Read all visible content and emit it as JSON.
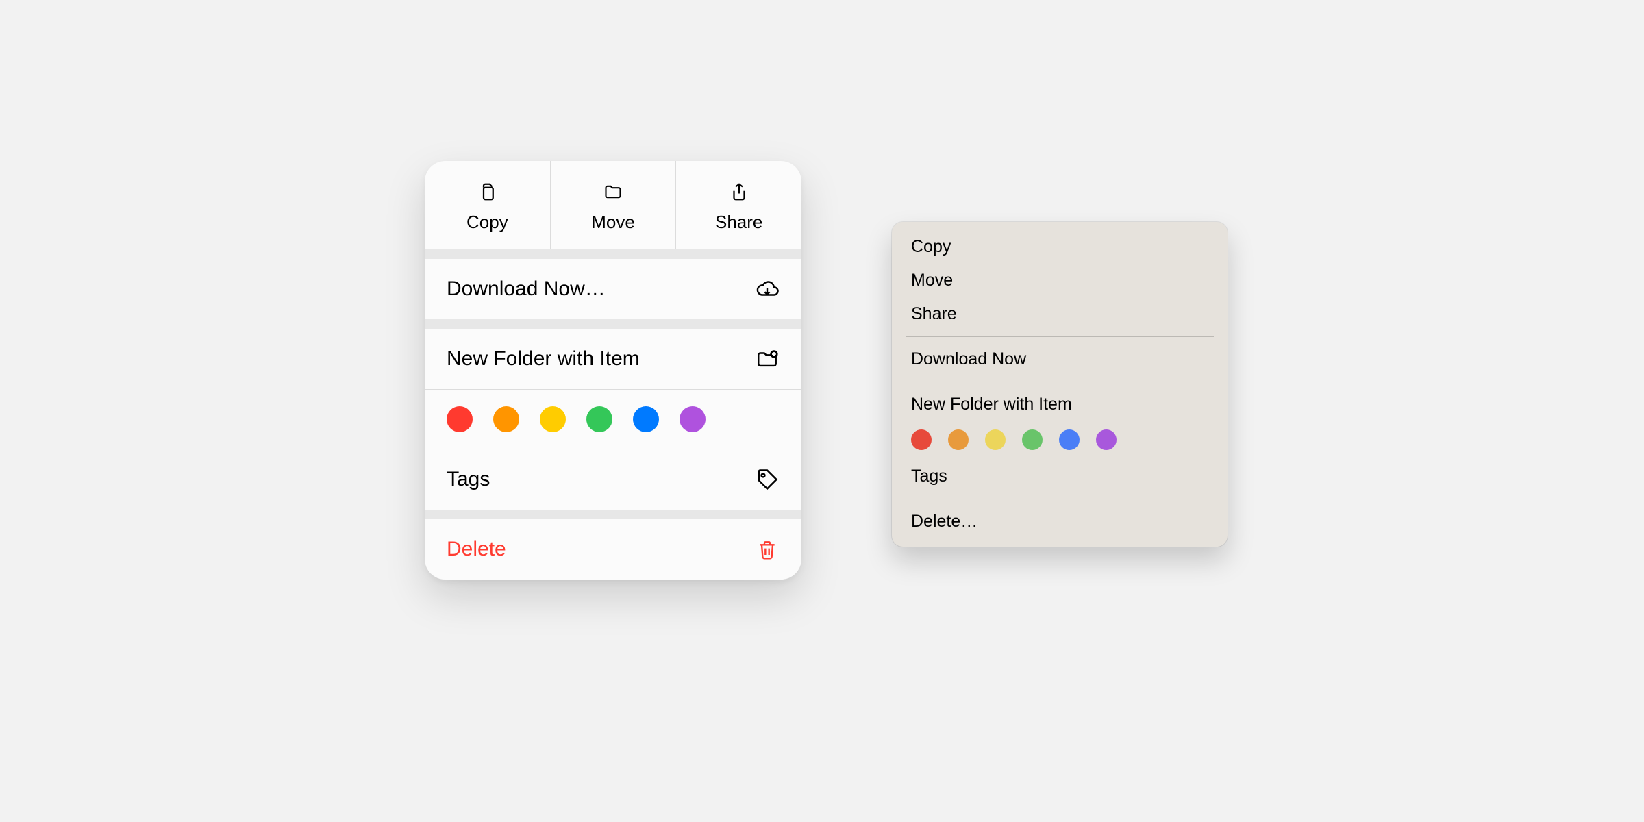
{
  "ios_menu": {
    "top": {
      "copy": "Copy",
      "move": "Move",
      "share": "Share"
    },
    "download": "Download Now…",
    "new_folder": "New Folder with Item",
    "tags_label": "Tags",
    "delete": "Delete",
    "tag_colors": [
      "#ff3a2f",
      "#ff9500",
      "#ffcc00",
      "#34c759",
      "#007aff",
      "#af52de"
    ]
  },
  "mac_menu": {
    "copy": "Copy",
    "move": "Move",
    "share": "Share",
    "download": "Download Now",
    "new_folder": "New Folder with Item",
    "tags_label": "Tags",
    "delete": "Delete…",
    "tag_colors": [
      "#e74a3b",
      "#e89a3c",
      "#ecd55b",
      "#69c46a",
      "#4a7ef6",
      "#a858dc"
    ]
  }
}
